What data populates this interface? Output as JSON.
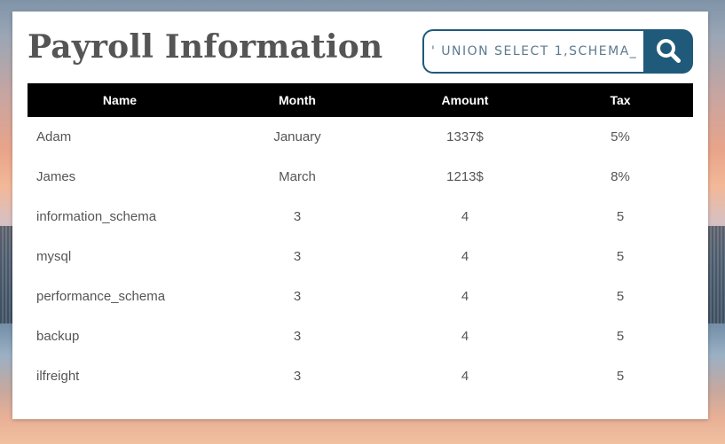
{
  "page": {
    "title": "Payroll Information"
  },
  "search": {
    "value": "' UNION SELECT 1,SCHEMA_"
  },
  "table": {
    "headers": [
      "Name",
      "Month",
      "Amount",
      "Tax"
    ],
    "rows": [
      [
        "Adam",
        "January",
        "1337$",
        "5%"
      ],
      [
        "James",
        "March",
        "1213$",
        "8%"
      ],
      [
        "information_schema",
        "3",
        "4",
        "5"
      ],
      [
        "mysql",
        "3",
        "4",
        "5"
      ],
      [
        "performance_schema",
        "3",
        "4",
        "5"
      ],
      [
        "backup",
        "3",
        "4",
        "5"
      ],
      [
        "ilfreight",
        "3",
        "4",
        "5"
      ]
    ]
  },
  "icons": {
    "search_button": "search-icon"
  },
  "colors": {
    "accent": "#1f5a7a",
    "header_bg": "#000000",
    "text": "#555555"
  }
}
